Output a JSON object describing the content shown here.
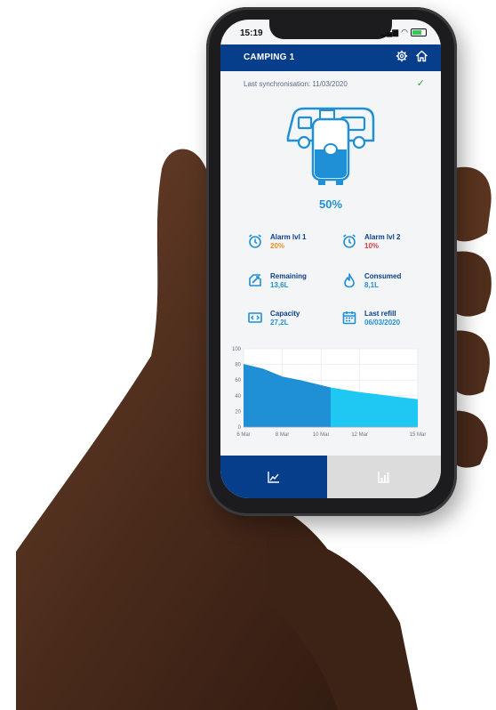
{
  "status": {
    "time": "15:19"
  },
  "header": {
    "title": "CAMPING 1"
  },
  "sync": {
    "text": "Last synchronisation: 11/03/2020",
    "ok_icon": "check-icon"
  },
  "tank": {
    "level_percent": 50,
    "level_label": "50%"
  },
  "metrics": {
    "alarm1": {
      "label": "Alarm lvl 1",
      "value": "20%",
      "color": "#f28c1e",
      "icon": "alarm-clock-icon"
    },
    "alarm2": {
      "label": "Alarm lvl 2",
      "value": "10%",
      "color": "#e23a3a",
      "icon": "alarm-clock-icon"
    },
    "remaining": {
      "label": "Remaining",
      "value": "13,6L",
      "color": "#1f8fd6",
      "icon": "remaining-icon"
    },
    "consumed": {
      "label": "Consumed",
      "value": "8,1L",
      "color": "#1f8fd6",
      "icon": "flame-icon"
    },
    "capacity": {
      "label": "Capacity",
      "value": "27,2L",
      "color": "#1f8fd6",
      "icon": "capacity-icon"
    },
    "last_refill": {
      "label": "Last refill",
      "value": "06/03/2020",
      "color": "#1f8fd6",
      "icon": "calendar-icon"
    }
  },
  "chart_data": {
    "type": "area",
    "ylim": [
      0,
      100
    ],
    "y_ticks": [
      "100",
      "80",
      "60",
      "40",
      "20",
      "0"
    ],
    "x_ticks": [
      "6 Mar",
      "8 Mar",
      "10 Mar",
      "12 Mar",
      "15 Mar"
    ],
    "series": [
      {
        "x": [
          6,
          7,
          8,
          9,
          10,
          10.5
        ],
        "values": [
          80,
          74,
          64,
          59,
          53,
          50
        ],
        "color": "#1f8fd6"
      },
      {
        "x": [
          10.5,
          12,
          13,
          14,
          15
        ],
        "values": [
          50,
          44,
          41,
          38,
          35
        ],
        "color": "#1ec8f2"
      }
    ]
  },
  "tabs": {
    "active": "chart-icon",
    "inactive": "bar-chart-icon"
  },
  "colors": {
    "brand": "#073e8c",
    "accent": "#1f8fd6"
  }
}
